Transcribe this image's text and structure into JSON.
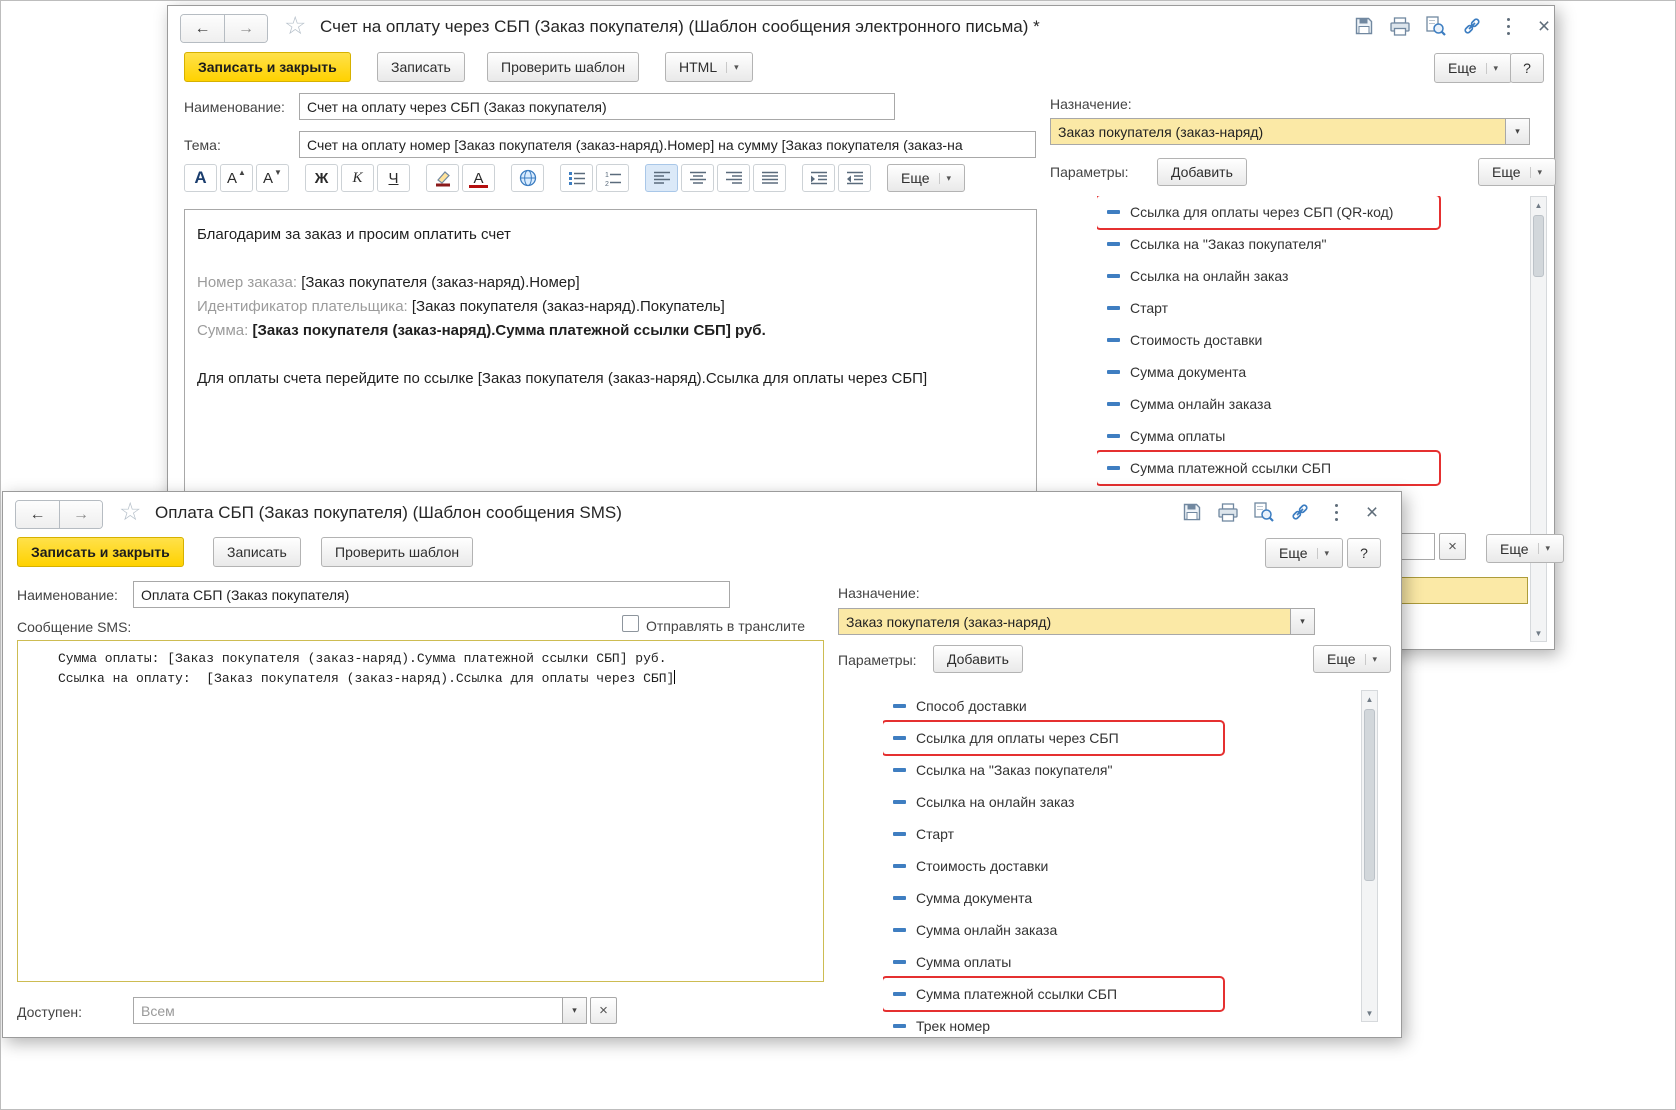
{
  "glyphs": {
    "back": "←",
    "forward": "→",
    "star": "☆",
    "close": "×",
    "dropdown": "▾",
    "scroll_up": "▲",
    "scroll_down": "▼",
    "clear": "×"
  },
  "colors": {
    "accent_yellow": "#ffd200",
    "field_yellow": "#fbe9a6",
    "highlight_red": "#e53030",
    "param_blue": "#3f7ec1"
  },
  "email_window": {
    "title": "Счет на оплату через СБП (Заказ покупателя) (Шаблон сообщения электронного письма) *",
    "commands": {
      "save_close": "Записать и закрыть",
      "save": "Записать",
      "check": "Проверить шаблон",
      "html": "HTML",
      "more": "Еще",
      "help": "?"
    },
    "name_label": "Наименование:",
    "name_value": "Счет на оплату через СБП (Заказ покупателя)",
    "subject_label": "Тема:",
    "subject_value": "Счет на оплату номер [Заказ покупателя (заказ-наряд).Номер] на сумму [Заказ покупателя (заказ-на",
    "format": {
      "font": "А",
      "bold": "Ж",
      "italic": "К",
      "underline": "Ч",
      "more": "Еще"
    },
    "body": {
      "greeting": "Благодарим за заказ и просим оплатить счет",
      "order_label": "Номер заказа:",
      "order_value": "[Заказ покупателя (заказ-наряд).Номер]",
      "payer_label": "Идентификатор плательщика:",
      "payer_value": "[Заказ покупателя (заказ-наряд).Покупатель]",
      "sum_label": "Сумма:",
      "sum_value": "[Заказ покупателя (заказ-наряд).Сумма платежной ссылки СБП] руб.",
      "pay_line": "Для оплаты счета перейдите по ссылке [Заказ покупателя (заказ-наряд).Ссылка для оплаты через СБП]"
    },
    "assignment_label": "Назначение:",
    "assignment_value": "Заказ покупателя (заказ-наряд)",
    "params_label": "Параметры:",
    "add_button": "Добавить",
    "params_more": "Еще",
    "params": [
      {
        "label": "Ссылка для оплаты через СБП (QR-код)",
        "highlighted": true
      },
      {
        "label": "Ссылка на \"Заказ покупателя\"",
        "highlighted": false
      },
      {
        "label": "Ссылка на онлайн заказ",
        "highlighted": false
      },
      {
        "label": "Старт",
        "highlighted": false
      },
      {
        "label": "Стоимость доставки",
        "highlighted": false
      },
      {
        "label": "Сумма документа",
        "highlighted": false
      },
      {
        "label": "Сумма онлайн заказа",
        "highlighted": false
      },
      {
        "label": "Сумма оплаты",
        "highlighted": false
      },
      {
        "label": "Сумма платежной ссылки СБП",
        "highlighted": true
      }
    ],
    "bottom_more": "Еще"
  },
  "sms_window": {
    "title": "Оплата СБП (Заказ покупателя) (Шаблон сообщения SMS)",
    "commands": {
      "save_close": "Записать и закрыть",
      "save": "Записать",
      "check": "Проверить шаблон",
      "more": "Еще",
      "help": "?"
    },
    "name_label": "Наименование:",
    "name_value": "Оплата СБП (Заказ покупателя)",
    "message_label": "Сообщение SMS:",
    "translit_label": "Отправлять в транслите",
    "message_lines": [
      "Сумма оплаты: [Заказ покупателя (заказ-наряд).Сумма платежной ссылки СБП] руб.",
      "Ссылка на оплату:  [Заказ покупателя (заказ-наряд).Ссылка для оплаты через СБП]"
    ],
    "available_label": "Доступен:",
    "available_placeholder": "Всем",
    "assignment_label": "Назначение:",
    "assignment_value": "Заказ покупателя (заказ-наряд)",
    "params_label": "Параметры:",
    "add_button": "Добавить",
    "params_more": "Еще",
    "params": [
      {
        "label": "Способ доставки",
        "highlighted": false
      },
      {
        "label": "Ссылка для оплаты через СБП",
        "highlighted": true
      },
      {
        "label": "Ссылка на \"Заказ покупателя\"",
        "highlighted": false
      },
      {
        "label": "Ссылка на онлайн заказ",
        "highlighted": false
      },
      {
        "label": "Старт",
        "highlighted": false
      },
      {
        "label": "Стоимость доставки",
        "highlighted": false
      },
      {
        "label": "Сумма документа",
        "highlighted": false
      },
      {
        "label": "Сумма онлайн заказа",
        "highlighted": false
      },
      {
        "label": "Сумма оплаты",
        "highlighted": false
      },
      {
        "label": "Сумма платежной ссылки СБП",
        "highlighted": true
      },
      {
        "label": "Трек номер",
        "highlighted": false
      }
    ]
  }
}
